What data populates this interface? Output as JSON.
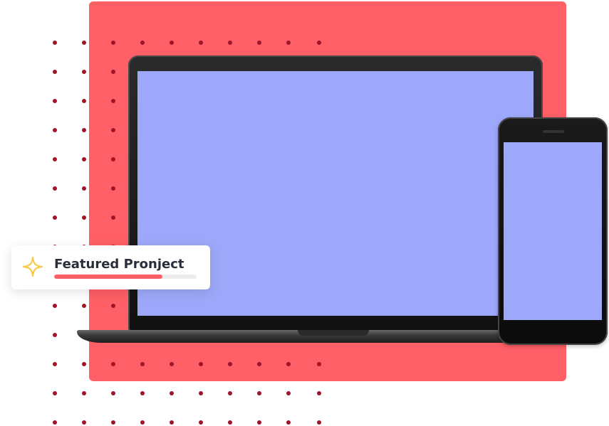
{
  "colors": {
    "panel": "#ff5f66",
    "screen": "#9ea8fa",
    "dots": "#a0142a",
    "accent": "#ff5f66",
    "star": "#f7c948"
  },
  "badge": {
    "icon": "sparkle-icon",
    "title": "Featured Pronject",
    "progress": 0.76
  },
  "devices": {
    "laptop": "laptop-mockup",
    "phone": "phone-mockup"
  }
}
